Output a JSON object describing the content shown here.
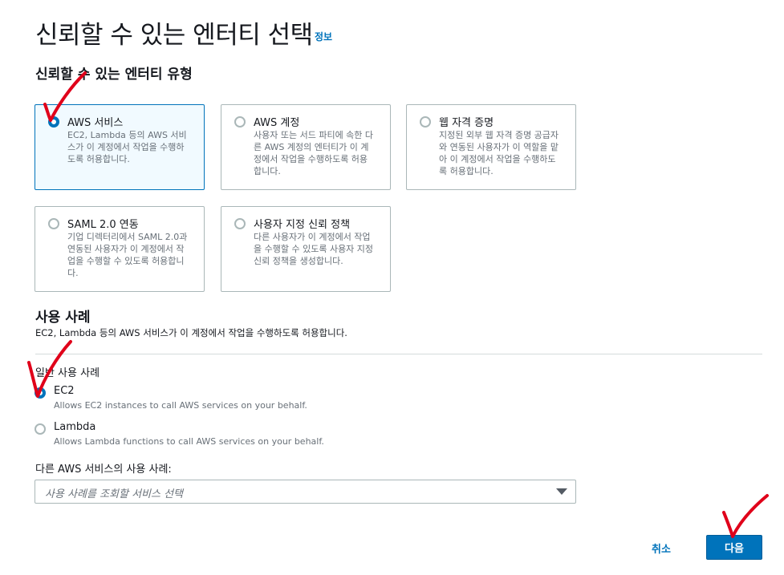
{
  "header": {
    "title": "신뢰할 수 있는 엔터티 선택",
    "info": "정보"
  },
  "trusted_entity": {
    "heading": "신뢰할 수 있는 엔터티 유형",
    "options": [
      {
        "label": "AWS 서비스",
        "desc": "EC2, Lambda 등의 AWS 서비스가 이 계정에서 작업을 수행하도록 허용합니다.",
        "selected": true
      },
      {
        "label": "AWS 계정",
        "desc": "사용자 또는 서드 파티에 속한 다른 AWS 계정의 엔터티가 이 계정에서 작업을 수행하도록 허용합니다.",
        "selected": false
      },
      {
        "label": "웹 자격 증명",
        "desc": "지정된 외부 웹 자격 증명 공급자와 연동된 사용자가 이 역할을 맡아 이 계정에서 작업을 수행하도록 허용합니다.",
        "selected": false
      },
      {
        "label": "SAML 2.0 연동",
        "desc": "기업 디렉터리에서 SAML 2.0과 연동된 사용자가 이 계정에서 작업을 수행할 수 있도록 허용합니다.",
        "selected": false
      },
      {
        "label": "사용자 지정 신뢰 정책",
        "desc": "다른 사용자가 이 계정에서 작업을 수행할 수 있도록 사용자 지정 신뢰 정책을 생성합니다.",
        "selected": false
      }
    ]
  },
  "use_case": {
    "heading": "사용 사례",
    "description": "EC2, Lambda 등의 AWS 서비스가 이 계정에서 작업을 수행하도록 허용합니다.",
    "common_label": "일반 사용 사례",
    "options": [
      {
        "label": "EC2",
        "desc": "Allows EC2 instances to call AWS services on your behalf.",
        "selected": true
      },
      {
        "label": "Lambda",
        "desc": "Allows Lambda functions to call AWS services on your behalf.",
        "selected": false
      }
    ],
    "other_label": "다른 AWS 서비스의 사용 사례:",
    "select_placeholder": "사용 사례를 조회할 서비스 선택"
  },
  "footer": {
    "cancel": "취소",
    "next": "다음"
  },
  "colors": {
    "accent": "#0073bb",
    "annotation": "#e0001a"
  }
}
